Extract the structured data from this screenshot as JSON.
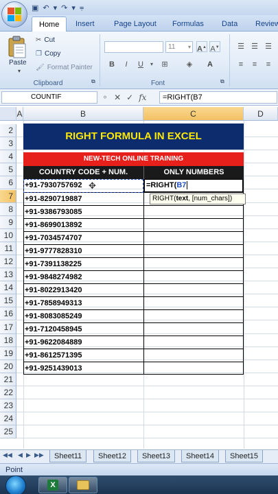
{
  "ribbon": {
    "tabs": [
      "Home",
      "Insert",
      "Page Layout",
      "Formulas",
      "Data",
      "Review"
    ],
    "active_tab": "Home",
    "clipboard": {
      "paste_label": "Paste",
      "cut_label": "Cut",
      "copy_label": "Copy",
      "format_painter_label": "Format Painter",
      "group_label": "Clipboard"
    },
    "font": {
      "font_size": "11",
      "group_label": "Font",
      "bold": "B",
      "italic": "I",
      "underline": "U"
    }
  },
  "formula_bar": {
    "name_box": "COUNTIF",
    "cancel_glyph": "✕",
    "enter_glyph": "✓",
    "fx_label": "fx",
    "formula": "=RIGHT(B7"
  },
  "columns": [
    "A",
    "B",
    "C",
    "D"
  ],
  "rows": [
    "2",
    "3",
    "4",
    "5",
    "6",
    "7",
    "8",
    "9",
    "10",
    "11",
    "12",
    "13",
    "14",
    "15",
    "16",
    "17",
    "18",
    "19",
    "20",
    "21",
    "22",
    "23",
    "24",
    "25"
  ],
  "sheet": {
    "title": "RIGHT FORMULA IN EXCEL",
    "subtitle": "NEW-TECH ONLINE TRAINING",
    "header_country": "COUNTRY CODE + NUM.",
    "header_numbers": "ONLY NUMBERS",
    "entries": [
      "+91-7930757692",
      "+91-8290719887",
      "+91-9386793085",
      "+91-8699013892",
      "+91-7034574707",
      "+91-9777828310",
      "+91-7391138225",
      "+91-9848274982",
      "+91-8022913420",
      "+91-7858949313",
      "+91-8083085249",
      "+91-7120458945",
      "+91-9622084889",
      "+91-8612571395",
      "+91-9251439013"
    ],
    "editing_cell_text": "=RIGHT(",
    "editing_cell_ref": "B7",
    "tooltip": {
      "func": "RIGHT(",
      "arg1": "text",
      "rest": ", [num_chars])"
    }
  },
  "sheet_tabs": [
    "Sheet11",
    "Sheet12",
    "Sheet13",
    "Sheet14",
    "Sheet15"
  ],
  "status": "Point",
  "colors": {
    "title_bg": "#0d2c6e",
    "title_fg": "#ffe800",
    "subtitle_bg": "#e8201b",
    "header_bg": "#1a1a1a"
  }
}
